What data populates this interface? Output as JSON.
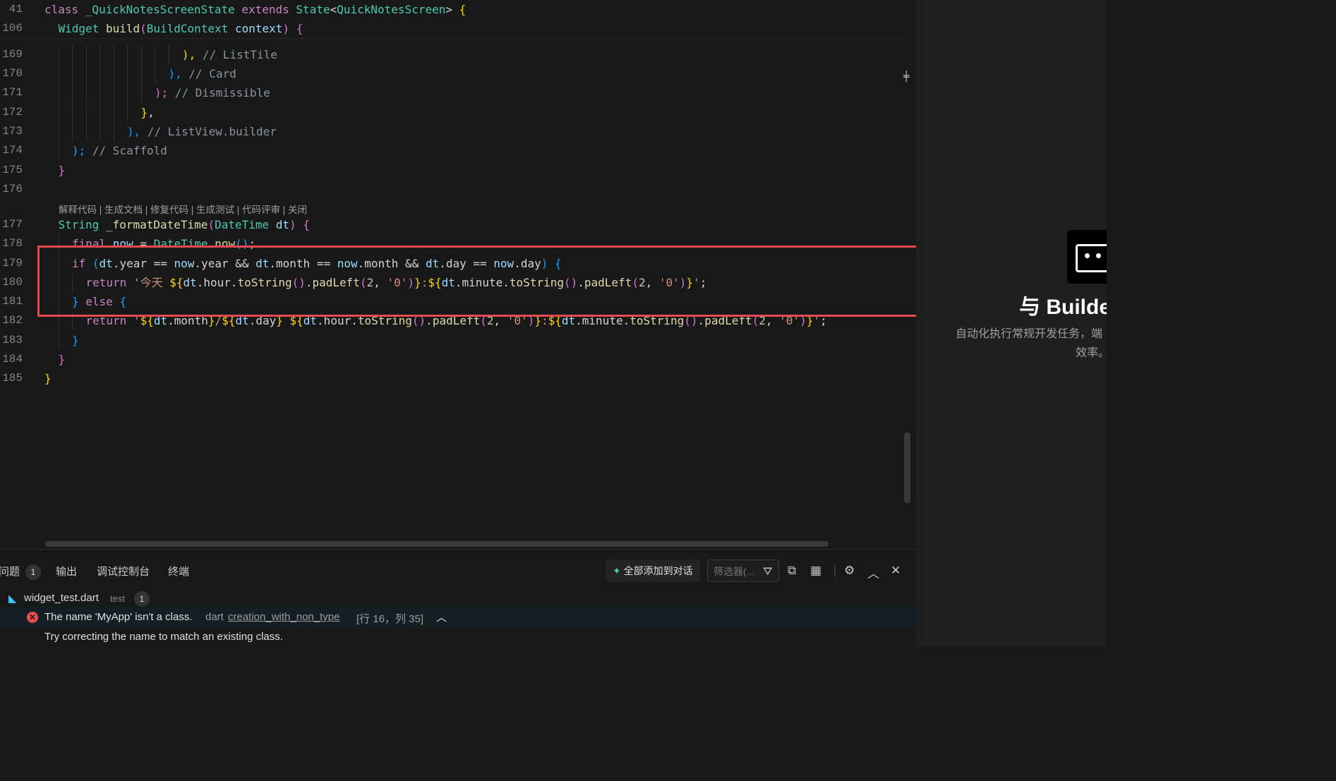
{
  "sticky": [
    {
      "ln": "41",
      "indent": 0,
      "tokens": [
        [
          "class ",
          "kw"
        ],
        [
          "_QuickNotesScreenState ",
          "ty"
        ],
        [
          "extends ",
          "kw"
        ],
        [
          "State",
          "ty"
        ],
        [
          "<",
          "plain"
        ],
        [
          "QuickNotesScreen",
          "ty"
        ],
        [
          ">",
          "plain"
        ],
        [
          " {",
          "b1"
        ]
      ]
    },
    {
      "ln": "106",
      "indent": 1,
      "tokens": [
        [
          "Widget ",
          "ty"
        ],
        [
          "build",
          "fn"
        ],
        [
          "(",
          "b2"
        ],
        [
          "BuildContext ",
          "ty"
        ],
        [
          "context",
          "vr"
        ],
        [
          ")",
          "b2"
        ],
        [
          " {",
          "b2"
        ]
      ]
    }
  ],
  "lines": [
    {
      "ln": "169",
      "indent": 10,
      "tokens": [
        [
          "), ",
          "b1"
        ],
        [
          "// ListTile",
          "cm"
        ]
      ]
    },
    {
      "ln": "170",
      "indent": 9,
      "tokens": [
        [
          "), ",
          "b3"
        ],
        [
          "// Card",
          "cm"
        ]
      ]
    },
    {
      "ln": "171",
      "indent": 8,
      "tokens": [
        [
          "); ",
          "b2"
        ],
        [
          "// Dismissible",
          "cm"
        ]
      ]
    },
    {
      "ln": "172",
      "indent": 7,
      "tokens": [
        [
          "}",
          "b1"
        ],
        [
          ",",
          "plain"
        ]
      ]
    },
    {
      "ln": "173",
      "indent": 6,
      "tokens": [
        [
          "), ",
          "b3"
        ],
        [
          "// ListView.builder",
          "cm"
        ]
      ]
    },
    {
      "ln": "174",
      "indent": 2,
      "tokens": [
        [
          "); ",
          "b3"
        ],
        [
          "// Scaffold",
          "cm"
        ]
      ]
    },
    {
      "ln": "175",
      "indent": 1,
      "tokens": [
        [
          "}",
          "b2"
        ]
      ]
    },
    {
      "ln": "176",
      "indent": 0,
      "tokens": []
    },
    {
      "ln": "177",
      "indent": 1,
      "tokens": [
        [
          "String ",
          "ty"
        ],
        [
          "_formatDateTime",
          "fn"
        ],
        [
          "(",
          "b2"
        ],
        [
          "DateTime ",
          "ty"
        ],
        [
          "dt",
          "vr"
        ],
        [
          ")",
          "b2"
        ],
        [
          " {",
          "b2"
        ]
      ]
    },
    {
      "ln": "178",
      "indent": 2,
      "tokens": [
        [
          "final ",
          "kw"
        ],
        [
          "now ",
          "vr"
        ],
        [
          "= ",
          "plain"
        ],
        [
          "DateTime",
          "ty"
        ],
        [
          ".",
          "plain"
        ],
        [
          "now",
          "fn"
        ],
        [
          "()",
          "b3"
        ],
        [
          ";",
          "plain"
        ]
      ]
    },
    {
      "ln": "179",
      "indent": 2,
      "tokens": [
        [
          "if ",
          "kw"
        ],
        [
          "(",
          "b3"
        ],
        [
          "dt",
          "vr"
        ],
        [
          ".year == ",
          "plain"
        ],
        [
          "now",
          "vr"
        ],
        [
          ".year && ",
          "plain"
        ],
        [
          "dt",
          "vr"
        ],
        [
          ".month == ",
          "plain"
        ],
        [
          "now",
          "vr"
        ],
        [
          ".month && ",
          "plain"
        ],
        [
          "dt",
          "vr"
        ],
        [
          ".day == ",
          "plain"
        ],
        [
          "now",
          "vr"
        ],
        [
          ".day",
          "plain"
        ],
        [
          ")",
          "b3"
        ],
        [
          " {",
          "b3"
        ]
      ]
    },
    {
      "ln": "180",
      "indent": 3,
      "tokens": [
        [
          "return ",
          "kw"
        ],
        [
          "'今天 ",
          "str"
        ],
        [
          "${",
          "b1"
        ],
        [
          "dt",
          "vr"
        ],
        [
          ".hour.",
          "plain"
        ],
        [
          "toString",
          "fn"
        ],
        [
          "()",
          "b2"
        ],
        [
          ".",
          "plain"
        ],
        [
          "padLeft",
          "fn"
        ],
        [
          "(",
          "b2"
        ],
        [
          "2",
          "num"
        ],
        [
          ", ",
          "plain"
        ],
        [
          "'0'",
          "str"
        ],
        [
          ")",
          "b2"
        ],
        [
          "}",
          "b1"
        ],
        [
          ":",
          "str"
        ],
        [
          "${",
          "b1"
        ],
        [
          "dt",
          "vr"
        ],
        [
          ".minute.",
          "plain"
        ],
        [
          "toString",
          "fn"
        ],
        [
          "()",
          "b2"
        ],
        [
          ".",
          "plain"
        ],
        [
          "padLeft",
          "fn"
        ],
        [
          "(",
          "b2"
        ],
        [
          "2",
          "num"
        ],
        [
          ", ",
          "plain"
        ],
        [
          "'0'",
          "str"
        ],
        [
          ")",
          "b2"
        ],
        [
          "}",
          "b1"
        ],
        [
          "'",
          "str"
        ],
        [
          ";",
          "plain"
        ]
      ]
    },
    {
      "ln": "181",
      "indent": 2,
      "tokens": [
        [
          "} ",
          "b3"
        ],
        [
          "else ",
          "kw"
        ],
        [
          "{",
          "b3"
        ]
      ]
    },
    {
      "ln": "182",
      "indent": 3,
      "tokens": [
        [
          "return ",
          "kw"
        ],
        [
          "'",
          "str"
        ],
        [
          "${",
          "b1"
        ],
        [
          "dt",
          "vr"
        ],
        [
          ".month",
          "plain"
        ],
        [
          "}",
          "b1"
        ],
        [
          "/",
          "str"
        ],
        [
          "${",
          "b1"
        ],
        [
          "dt",
          "vr"
        ],
        [
          ".day",
          "plain"
        ],
        [
          "} ",
          "b1"
        ],
        [
          "${",
          "b1"
        ],
        [
          "dt",
          "vr"
        ],
        [
          ".hour.",
          "plain"
        ],
        [
          "toString",
          "fn"
        ],
        [
          "()",
          "b2"
        ],
        [
          ".",
          "plain"
        ],
        [
          "padLeft",
          "fn"
        ],
        [
          "(",
          "b2"
        ],
        [
          "2",
          "num"
        ],
        [
          ", ",
          "plain"
        ],
        [
          "'0'",
          "str"
        ],
        [
          ")",
          "b2"
        ],
        [
          "}",
          "b1"
        ],
        [
          ":",
          "str"
        ],
        [
          "${",
          "b1"
        ],
        [
          "dt",
          "vr"
        ],
        [
          ".minute.",
          "plain"
        ],
        [
          "toString",
          "fn"
        ],
        [
          "()",
          "b2"
        ],
        [
          ".",
          "plain"
        ],
        [
          "padLeft",
          "fn"
        ],
        [
          "(",
          "b2"
        ],
        [
          "2",
          "num"
        ],
        [
          ", ",
          "plain"
        ],
        [
          "'0'",
          "str"
        ],
        [
          ")",
          "b2"
        ],
        [
          "}",
          "b1"
        ],
        [
          "'",
          "str"
        ],
        [
          ";",
          "plain"
        ]
      ]
    },
    {
      "ln": "183",
      "indent": 2,
      "tokens": [
        [
          "}",
          "b3"
        ]
      ]
    },
    {
      "ln": "184",
      "indent": 1,
      "tokens": [
        [
          "}",
          "b2"
        ]
      ]
    },
    {
      "ln": "185",
      "indent": 0,
      "tokens": [
        [
          "}",
          "b1"
        ]
      ]
    }
  ],
  "codelens": "解释代码 | 生成文档 | 修复代码 | 生成测试 | 代码评审 | 关闭",
  "right_panel": {
    "title": "与 Builde",
    "desc_line1": "自动化执行常规开发任务，端",
    "desc_line2": "效率。"
  },
  "bottom": {
    "tabs": [
      {
        "label": "问题",
        "badge": "1"
      },
      {
        "label": "输出"
      },
      {
        "label": "调试控制台"
      },
      {
        "label": "终端"
      }
    ],
    "add_all_label": "全部添加到对话",
    "filter_placeholder": "筛选器(...",
    "file": {
      "name": "widget_test.dart",
      "folder": "test",
      "count": "1"
    },
    "error": {
      "message": "The name 'MyApp' isn't a class.",
      "source": "dart",
      "code": "creation_with_non_type",
      "location": "[行 16，列 35]",
      "hint": "Try correcting the name to match an existing class."
    }
  },
  "colors": {
    "error": "#f14c4c",
    "highlight_box": "#e5484d"
  }
}
